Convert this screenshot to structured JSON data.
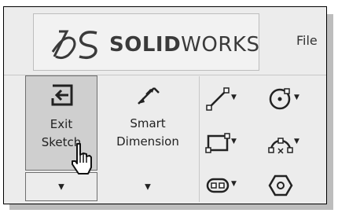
{
  "app": {
    "logo_text_bold": "SOLID",
    "logo_text_light": "WORKS",
    "menu_file": "File"
  },
  "toolbar": {
    "exit_sketch": {
      "line1": "Exit",
      "line2": "Sketch",
      "icon": "exit-sketch-icon"
    },
    "smart_dimension": {
      "line1": "Smart",
      "line2": "Dimension",
      "icon": "smart-dimension-icon"
    },
    "dropdown_glyph": "▼",
    "sketch_tools": [
      {
        "name": "line",
        "icon": "line-icon"
      },
      {
        "name": "circle",
        "icon": "circle-icon"
      },
      {
        "name": "rectangle",
        "icon": "rectangle-icon"
      },
      {
        "name": "arc",
        "icon": "arc-icon"
      },
      {
        "name": "slot",
        "icon": "slot-icon"
      },
      {
        "name": "polygon",
        "icon": "polygon-icon"
      }
    ]
  },
  "colors": {
    "pressed_button": "#cfcfcf",
    "toolbar_bg": "#ececec"
  }
}
